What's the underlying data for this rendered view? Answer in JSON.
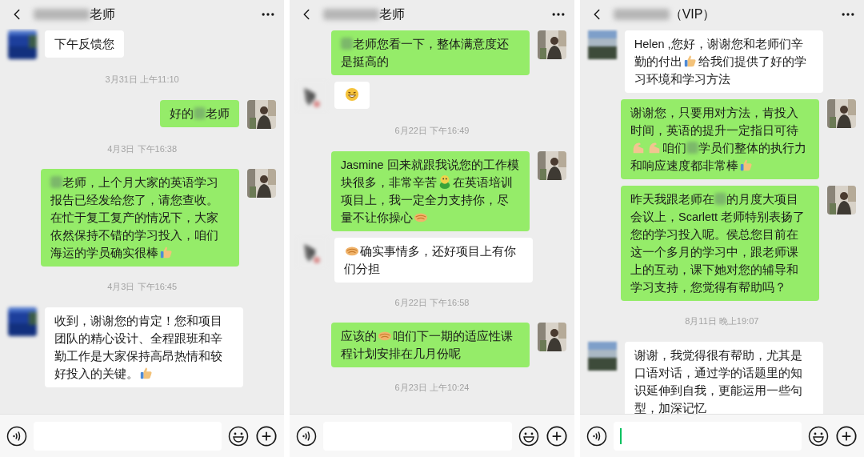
{
  "panels": [
    {
      "header": {
        "title": [
          {
            "kind": "blur"
          },
          {
            "kind": "text",
            "text": "老师"
          }
        ]
      },
      "messages": [
        {
          "kind": "incoming",
          "parts": [
            {
              "kind": "text",
              "text": "下午反馈您"
            }
          ]
        },
        {
          "kind": "time",
          "text": "3月31日 上午11:10"
        },
        {
          "kind": "outgoing",
          "parts": [
            {
              "kind": "text",
              "text": "好的"
            },
            {
              "kind": "blur"
            },
            {
              "kind": "text",
              "text": "老师"
            }
          ]
        },
        {
          "kind": "time",
          "text": "4月3日 下午16:38"
        },
        {
          "kind": "outgoing",
          "parts": [
            {
              "kind": "blur"
            },
            {
              "kind": "text",
              "text": "老师，上个月大家的英语学习报告已经发给您了，请您查收。在忙于复工复产的情况下，大家依然保持不错的学习投入，咱们海运的学员确实很棒"
            },
            {
              "kind": "thumbs"
            }
          ]
        },
        {
          "kind": "time",
          "text": "4月3日 下午16:45"
        },
        {
          "kind": "incoming",
          "parts": [
            {
              "kind": "text",
              "text": "收到，谢谢您的肯定！您和项目团队的精心设计、全程跟班和辛勤工作是大家保持高昂热情和较好投入的关键。"
            },
            {
              "kind": "thumbs"
            }
          ]
        }
      ],
      "input": {
        "focused": false
      }
    },
    {
      "header": {
        "title": [
          {
            "kind": "blur"
          },
          {
            "kind": "text",
            "text": "老师"
          }
        ]
      },
      "messages": [
        {
          "kind": "outgoing",
          "parts": [
            {
              "kind": "blur"
            },
            {
              "kind": "text",
              "text": "老师您看一下，整体满意度还是挺高的"
            }
          ]
        },
        {
          "kind": "incoming",
          "parts": [
            {
              "kind": "smile"
            }
          ]
        },
        {
          "kind": "time",
          "text": "6月22日 下午16:49"
        },
        {
          "kind": "outgoing",
          "parts": [
            {
              "kind": "text",
              "text": "Jasmine 回来就跟我说您的工作模块很多，非常辛苦"
            },
            {
              "kind": "tired"
            },
            {
              "kind": "text",
              "text": "在英语培训项目上，我一定全力支持你，尽量不让你操心"
            },
            {
              "kind": "handshake"
            }
          ]
        },
        {
          "kind": "incoming",
          "parts": [
            {
              "kind": "handshake"
            },
            {
              "kind": "text",
              "text": "确实事情多，还好项目上有你们分担"
            }
          ]
        },
        {
          "kind": "time",
          "text": "6月22日 下午16:58"
        },
        {
          "kind": "outgoing",
          "parts": [
            {
              "kind": "text",
              "text": "应该的"
            },
            {
              "kind": "handshake"
            },
            {
              "kind": "text",
              "text": "咱们下一期的适应性课程计划安排在几月份呢"
            }
          ]
        },
        {
          "kind": "time",
          "text": "6月23日 上午10:24"
        }
      ],
      "input": {
        "focused": false
      }
    },
    {
      "header": {
        "title": [
          {
            "kind": "blur"
          },
          {
            "kind": "text",
            "text": "（VIP）"
          }
        ]
      },
      "messages": [
        {
          "kind": "incoming",
          "parts": [
            {
              "kind": "text",
              "text": "Helen ,您好，谢谢您和老师们辛勤的付出"
            },
            {
              "kind": "thumbs"
            },
            {
              "kind": "text",
              "text": "给我们提供了好的学习环境和学习方法"
            }
          ]
        },
        {
          "kind": "outgoing",
          "parts": [
            {
              "kind": "text",
              "text": "谢谢您，只要用对方法，肯投入时间，英语的提升一定指日可待"
            },
            {
              "kind": "muscle"
            },
            {
              "kind": "muscle"
            },
            {
              "kind": "text",
              "text": "咱们"
            },
            {
              "kind": "blur"
            },
            {
              "kind": "text",
              "text": "学员们整体的执行力和响应速度都非常棒"
            },
            {
              "kind": "thumbs"
            }
          ]
        },
        {
          "kind": "outgoing",
          "parts": [
            {
              "kind": "text",
              "text": "昨天我跟老师在"
            },
            {
              "kind": "blur"
            },
            {
              "kind": "text",
              "text": "的月度大项目会议上，Scarlett 老师特别表扬了您的学习投入呢。侯总您目前在这一个多月的学习中，跟老师课上的互动，课下她对您的辅导和学习支持，您觉得有帮助吗？"
            }
          ]
        },
        {
          "kind": "time",
          "text": "8月11日 晚上19:07"
        },
        {
          "kind": "incoming",
          "parts": [
            {
              "kind": "text",
              "text": "谢谢，我觉得很有帮助，尤其是口语对话，通过学的话题里的知识延伸到自我，更能运用一些句型，加深记忆"
            }
          ]
        }
      ],
      "input": {
        "focused": true
      }
    }
  ]
}
